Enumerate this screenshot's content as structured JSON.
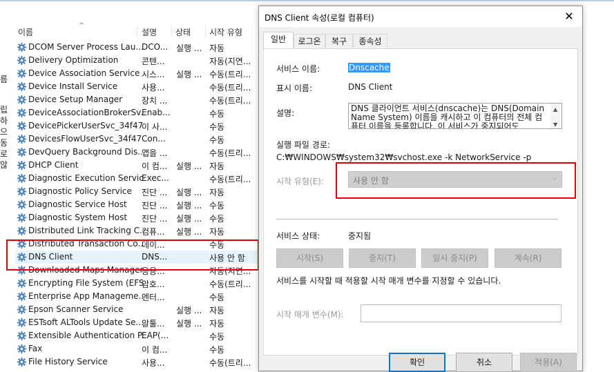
{
  "background": {
    "left_chars": [
      "름",
      "립",
      "하",
      "으",
      "동",
      "로",
      "않"
    ],
    "columns": {
      "name": "이름",
      "desc": "설명",
      "status": "상태",
      "startup": "시작 유형"
    },
    "services": [
      {
        "name": "DCOM Server Process Lau...",
        "desc": "DCO...",
        "status": "실행 ...",
        "startup": "자동"
      },
      {
        "name": "Delivery Optimization",
        "desc": "콘텐...",
        "status": "",
        "startup": "자동(지연..."
      },
      {
        "name": "Device Association Service",
        "desc": "시스...",
        "status": "실행 ...",
        "startup": "수동(트리..."
      },
      {
        "name": "Device Install Service",
        "desc": "사용...",
        "status": "",
        "startup": "수동(트리..."
      },
      {
        "name": "Device Setup Manager",
        "desc": "장치 ...",
        "status": "",
        "startup": "수동(트리..."
      },
      {
        "name": "DeviceAssociationBrokerSv...",
        "desc": "Enab...",
        "status": "",
        "startup": "수동"
      },
      {
        "name": "DevicePickerUserSvc_34f47",
        "desc": "이 사...",
        "status": "",
        "startup": "수동"
      },
      {
        "name": "DevicesFlowUserSvc_34f47",
        "desc": "Con...",
        "status": "",
        "startup": "수동"
      },
      {
        "name": "DevQuery Background Dis...",
        "desc": "앱을 ...",
        "status": "",
        "startup": "수동(트리..."
      },
      {
        "name": "DHCP Client",
        "desc": "이 컴...",
        "status": "실행 ...",
        "startup": "자동"
      },
      {
        "name": "Diagnostic Execution Service",
        "desc": "Exec...",
        "status": "",
        "startup": "수동(트리..."
      },
      {
        "name": "Diagnostic Policy Service",
        "desc": "진단 ...",
        "status": "실행 ...",
        "startup": "자동"
      },
      {
        "name": "Diagnostic Service Host",
        "desc": "진단 ...",
        "status": "실행 ...",
        "startup": "수동"
      },
      {
        "name": "Diagnostic System Host",
        "desc": "진단 ...",
        "status": "실행 ...",
        "startup": "수동"
      },
      {
        "name": "Distributed Link Tracking C...",
        "desc": "컴퓨...",
        "status": "실행 ...",
        "startup": "자동"
      },
      {
        "name": "Distributed Transaction Co...",
        "desc": "데이...",
        "status": "",
        "startup": "수동"
      },
      {
        "name": "DNS Client",
        "desc": "DNS...",
        "status": "",
        "startup": "사용 안 함"
      },
      {
        "name": "Downloaded Maps Manager",
        "desc": "응용...",
        "status": "",
        "startup": "자동(지연..."
      },
      {
        "name": "Encrypting File System (EFS)",
        "desc": "암호...",
        "status": "",
        "startup": "수동(트리..."
      },
      {
        "name": "Enterprise App Manageme...",
        "desc": "엔터...",
        "status": "",
        "startup": "수동"
      },
      {
        "name": "Epson Scanner Service",
        "desc": "",
        "status": "실행 ...",
        "startup": "자동"
      },
      {
        "name": "ESTsoft ALTools Update Se...",
        "desc": "알툴...",
        "status": "실행 ...",
        "startup": "자동"
      },
      {
        "name": "Extensible Authentication P...",
        "desc": "EAP(...",
        "status": "",
        "startup": "수동"
      },
      {
        "name": "Fax",
        "desc": "이 컴...",
        "status": "",
        "startup": "수동"
      },
      {
        "name": "File History Service",
        "desc": "사용...",
        "status": "",
        "startup": "수동(트리..."
      }
    ]
  },
  "dialog": {
    "title": "DNS Client 속성(로컬 컴퓨터)",
    "tabs": [
      "일반",
      "로그온",
      "복구",
      "종속성"
    ],
    "service_name_label": "서비스 이름:",
    "service_name": "Dnscache",
    "display_name_label": "표시 이름:",
    "display_name": "DNS Client",
    "description_label": "설명:",
    "description": "DNS 클라이언트 서비스(dnscache)는 DNS(Domain Name System) 이름을 캐시하고 이 컴퓨터의 전체 컴퓨터 이름을 등록합니다. 이 서비스가 중지되어도",
    "exe_path_label": "실행 파일 경로:",
    "exe_path": "C:₩WINDOWS₩system32₩svchost.exe -k NetworkService -p",
    "startup_type_label": "시작 유형(E):",
    "startup_type": "사용 안 함",
    "service_status_label": "서비스 상태:",
    "service_status": "중지됨",
    "buttons": {
      "start": "시작(S)",
      "stop": "중지(T)",
      "pause": "일시 중지(P)",
      "resume": "계속(R)"
    },
    "param_note": "서비스를 시작할 때 적용할 시작 매개 변수를 지정할 수 있습니다.",
    "param_label": "시작 매개 변수(M):",
    "param_value": "",
    "footer": {
      "ok": "확인",
      "cancel": "취소",
      "apply": "적용(A)"
    }
  },
  "colors": {
    "highlight": "#e00000",
    "selection": "#3399ff",
    "accent": "#0078d7"
  },
  "icons": {
    "service": "gear-icon",
    "close": "close-icon",
    "dropdown": "chevron-down-icon"
  }
}
